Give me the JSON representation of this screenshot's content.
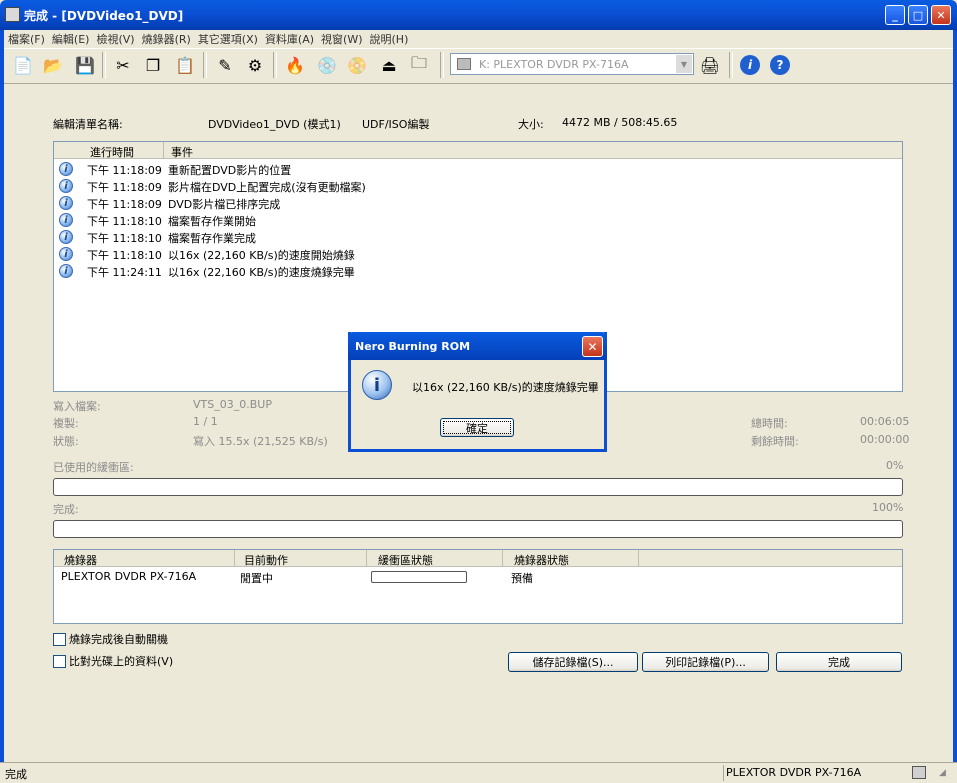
{
  "window": {
    "title": "完成 - [DVDVideo1_DVD]"
  },
  "menu": [
    "檔案(F)",
    "編輯(E)",
    "檢視(V)",
    "燒錄器(R)",
    "其它選項(X)",
    "資料庫(A)",
    "視窗(W)",
    "說明(H)"
  ],
  "toolbar": {
    "icons": [
      "new-file-icon",
      "open-folder-icon",
      "save-icon",
      "cut-icon",
      "copy-icon",
      "paste-icon",
      "edit-icon",
      "settings-icon",
      "burn-icon",
      "disc-copy-icon",
      "disc-info-icon",
      "eject-icon",
      "folder-icon",
      "recorder-icon",
      "info-icon",
      "help-icon"
    ],
    "recorder_select": "K: PLEXTOR  DVDR   PX-716A"
  },
  "compilation": {
    "label": "編輯清單名稱:",
    "name": "DVDVideo1_DVD (模式1)",
    "format": "UDF/ISO編製",
    "size_label": "大小:",
    "size": "4472 MB   /   508:45.65"
  },
  "log": {
    "columns": [
      "進行時間",
      "事件"
    ],
    "rows": [
      {
        "time": "下午 11:18:09",
        "event": "重新配置DVD影片的位置"
      },
      {
        "time": "下午 11:18:09",
        "event": "影片檔在DVD上配置完成(沒有更動檔案)"
      },
      {
        "time": "下午 11:18:09",
        "event": "DVD影片檔已排序完成"
      },
      {
        "time": "下午 11:18:10",
        "event": "檔案暫存作業開始"
      },
      {
        "time": "下午 11:18:10",
        "event": "檔案暫存作業完成"
      },
      {
        "time": "下午 11:18:10",
        "event": "以16x (22,160 KB/s)的速度開始燒錄"
      },
      {
        "time": "下午 11:24:11",
        "event": "以16x (22,160 KB/s)的速度燒錄完畢"
      }
    ]
  },
  "details": {
    "writing_file_label": "寫入檔案:",
    "writing_file": "VTS_03_0.BUP",
    "copies_label": "複製:",
    "copies": "1 / 1",
    "state_label": "狀態:",
    "state": "寫入 15.5x (21,525 KB/s)",
    "total_time_label": "總時間:",
    "total_time": "00:06:05",
    "remaining_label": "剩餘時間:",
    "remaining": "00:00:00",
    "buffer_label": "已使用的緩衝區:",
    "buffer_pct": "0%",
    "buffer_fraction": 0,
    "complete_label": "完成:",
    "complete_pct": "100%",
    "complete_fraction": 1
  },
  "recorders": {
    "columns": [
      "燒錄器",
      "目前動作",
      "緩衝區狀態",
      "燒錄器狀態"
    ],
    "rows": [
      {
        "recorder": "PLEXTOR DVDR   PX-716A",
        "action": "閒置中",
        "buffer": 0,
        "status": "預備"
      }
    ]
  },
  "options": {
    "shutdown": "燒錄完成後自動關機",
    "verify": "比對光碟上的資料(V)"
  },
  "buttons": {
    "save_log": "儲存記錄檔(S)...",
    "print_log": "列印記錄檔(P)...",
    "done": "完成"
  },
  "statusbar": {
    "left": "完成",
    "right": "PLEXTOR  DVDR   PX-716A"
  },
  "dialog": {
    "title": "Nero Burning ROM",
    "message": "以16x (22,160 KB/s)的速度燒錄完畢",
    "ok": "確定"
  }
}
